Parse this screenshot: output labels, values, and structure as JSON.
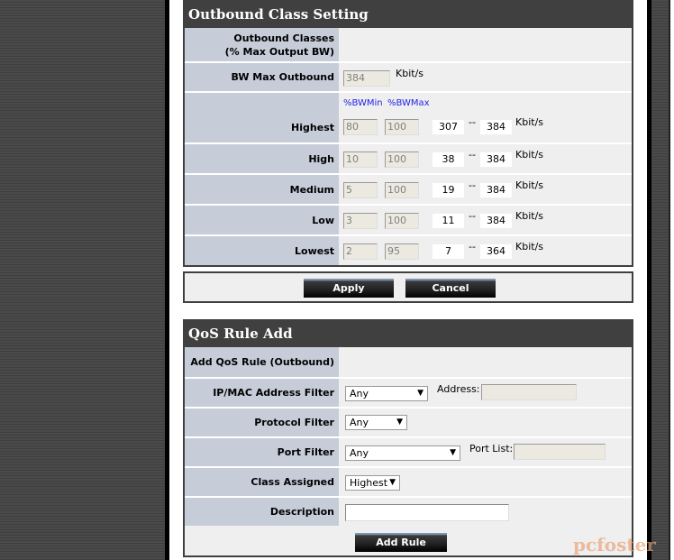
{
  "outbound": {
    "title": "Outbound Class Setting",
    "classes_label": "Outbound Classes\n(% Max Output BW)",
    "bw_label": "BW Max Outbound",
    "bw_value": "384",
    "unit": "Kbit/s",
    "col_min": "%BWMin",
    "col_max": "%BWMax",
    "dash": "--",
    "rows": [
      {
        "label": "Highest",
        "min": "80",
        "max": "100",
        "kmin": "307",
        "kmax": "384"
      },
      {
        "label": "High",
        "min": "10",
        "max": "100",
        "kmin": "38",
        "kmax": "384"
      },
      {
        "label": "Medium",
        "min": "5",
        "max": "100",
        "kmin": "19",
        "kmax": "384"
      },
      {
        "label": "Low",
        "min": "3",
        "max": "100",
        "kmin": "11",
        "kmax": "384"
      },
      {
        "label": "Lowest",
        "min": "2",
        "max": "95",
        "kmin": "7",
        "kmax": "364"
      }
    ],
    "apply": "Apply",
    "cancel": "Cancel"
  },
  "qos": {
    "title": "QoS Rule Add",
    "add_label": "Add QoS Rule (Outbound)",
    "ipmac_label": "IP/MAC Address Filter",
    "ipmac_value": "Any",
    "address_label": "Address:",
    "address_value": "",
    "protocol_label": "Protocol Filter",
    "protocol_value": "Any",
    "port_label": "Port Filter",
    "port_value": "Any",
    "portlist_label": "Port List:",
    "portlist_value": "",
    "class_label": "Class Assigned",
    "class_value": "Highest",
    "desc_label": "Description",
    "desc_value": "",
    "add_button": "Add Rule"
  },
  "watermark": "pcfoster"
}
